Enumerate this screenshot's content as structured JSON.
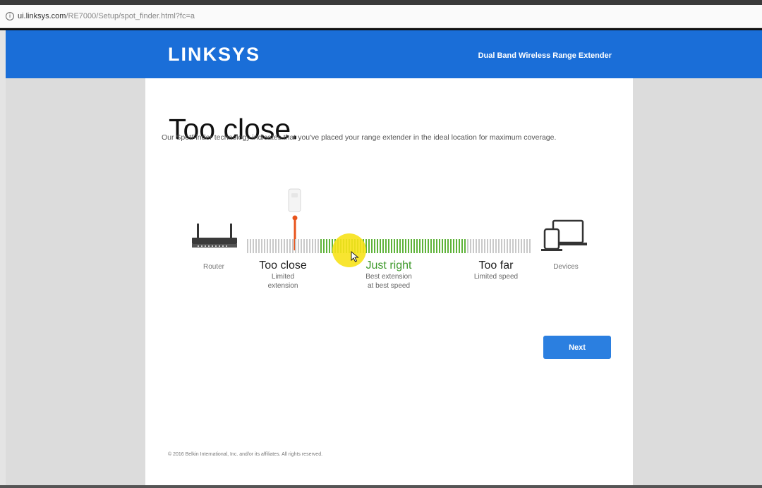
{
  "browser": {
    "url_host": "ui.linksys.com",
    "url_path": "/RE7000/Setup/spot_finder.html?fc=a"
  },
  "header": {
    "logo": "LINKSYS",
    "subtitle": "Dual Band Wireless Range Extender"
  },
  "main": {
    "title": "Too close.",
    "description": "Our SpotFinder technology indicates that you've placed your range extender in the ideal location for maximum coverage."
  },
  "spotfinder": {
    "router_label": "Router",
    "devices_label": "Devices",
    "zones": [
      {
        "title": "Too close",
        "sub1": "Limited",
        "sub2": "extension"
      },
      {
        "title": "Just right",
        "sub1": "Best extension",
        "sub2": "at best speed"
      },
      {
        "title": "Too far",
        "sub1": "Limited speed",
        "sub2": ""
      }
    ],
    "colors": {
      "tick_gray": "#c9c9c9",
      "tick_green": "#5fb33a",
      "marker": "#e8541c",
      "cursor_highlight": "#f7e21a"
    }
  },
  "actions": {
    "next_label": "Next"
  },
  "footer": {
    "copyright": "© 2016 Belkin International, Inc. and/or its affiliates. All rights reserved."
  }
}
